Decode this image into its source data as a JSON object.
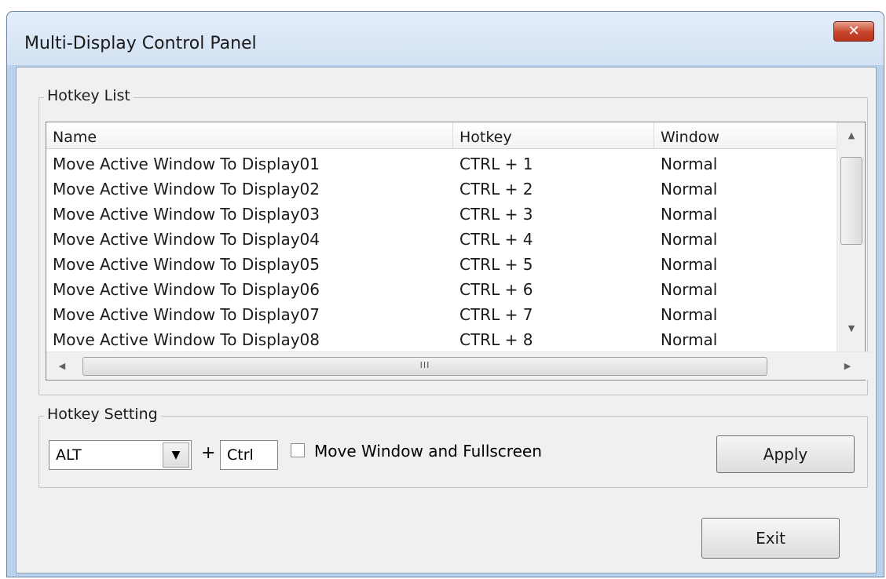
{
  "window": {
    "title": "Multi-Display Control Panel",
    "close_symbol": "✕"
  },
  "hotkey_list": {
    "label": "Hotkey List",
    "columns": [
      "Name",
      "Hotkey",
      "Window"
    ],
    "rows": [
      {
        "name": "Move Active Window To Display01",
        "hotkey": "CTRL + 1",
        "window": "Normal"
      },
      {
        "name": "Move Active Window To Display02",
        "hotkey": "CTRL + 2",
        "window": "Normal"
      },
      {
        "name": "Move Active Window To Display03",
        "hotkey": "CTRL + 3",
        "window": "Normal"
      },
      {
        "name": "Move Active Window To Display04",
        "hotkey": "CTRL + 4",
        "window": "Normal"
      },
      {
        "name": "Move Active Window To Display05",
        "hotkey": "CTRL + 5",
        "window": "Normal"
      },
      {
        "name": "Move Active Window To Display06",
        "hotkey": "CTRL + 6",
        "window": "Normal"
      },
      {
        "name": "Move Active Window To Display07",
        "hotkey": "CTRL + 7",
        "window": "Normal"
      },
      {
        "name": "Move Active Window To Display08",
        "hotkey": "CTRL + 8",
        "window": "Normal"
      }
    ],
    "scroll_arrows": {
      "up": "▲",
      "down": "▼",
      "left": "◀",
      "right": "▶",
      "thumb_grip": "III"
    }
  },
  "hotkey_setting": {
    "label": "Hotkey Setting",
    "modifier_value": "ALT",
    "combo_arrow": "▼",
    "plus": "+",
    "key_value": "Ctrl",
    "checkbox_label": "Move Window and Fullscreen",
    "checkbox_checked": false,
    "apply_label": "Apply"
  },
  "footer": {
    "exit_label": "Exit"
  }
}
